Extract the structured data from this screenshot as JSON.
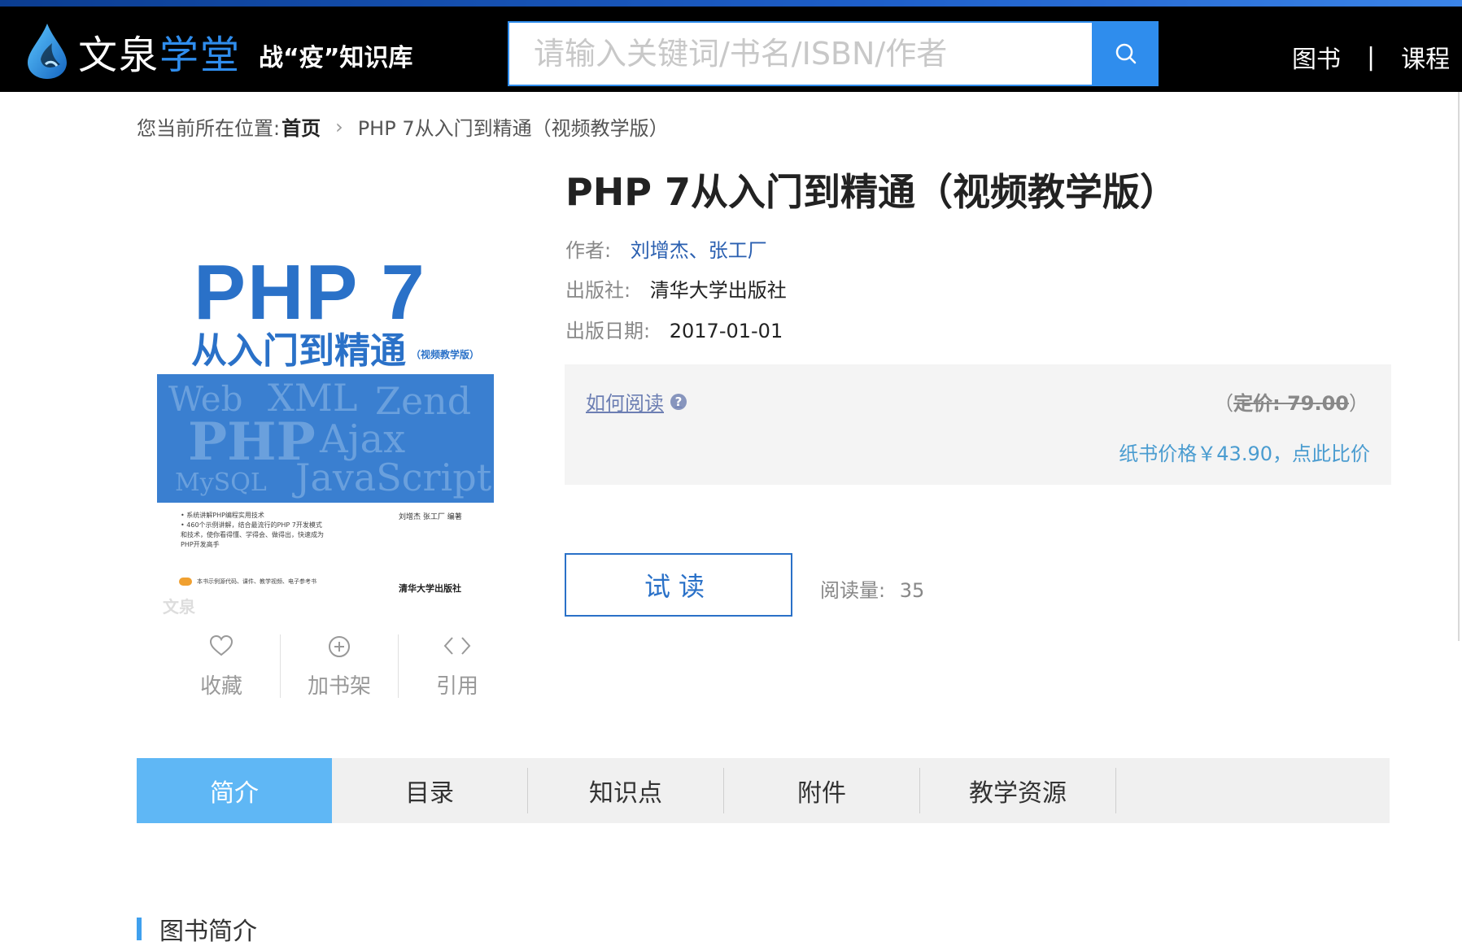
{
  "header": {
    "logo_main": "文泉",
    "logo_accent": "学堂",
    "logo_tag": "战“疫”知识库",
    "search_placeholder": "请输入关键词/书名/ISBN/作者",
    "nav": [
      "图书",
      "|",
      "课程"
    ]
  },
  "breadcrumb": {
    "prefix": "您当前所在位置:",
    "home": "首页",
    "current": "PHP 7从入门到精通（视频教学版）"
  },
  "cover": {
    "title_line1": "PHP 7",
    "title_line2": "从入门到精通",
    "title_edition": "（视频教学版）",
    "watermark_words": [
      "Web",
      "XML",
      "Zend",
      "PHP",
      "Ajax",
      "MySQL",
      "JavaScript"
    ],
    "bullets": [
      "• 系统讲解PHP编程实用技术",
      "• 460个示例讲解，结合最流行的PHP 7开发模式和技术，使你看得懂、学得会、做得出，快速成为PHP开发高手"
    ],
    "author": "刘增杰 张工厂 编著",
    "footer_note": "本书示例源代码、课件、教学视频、电子参考书",
    "publisher": "清华大学出版社",
    "watermark_logo": "文泉"
  },
  "actions": [
    {
      "label": "收藏",
      "icon": "heart-icon"
    },
    {
      "label": "加书架",
      "icon": "plus-circle-icon"
    },
    {
      "label": "引用",
      "icon": "code-brackets-icon"
    }
  ],
  "book": {
    "title": "PHP 7从入门到精通（视频教学版）",
    "author_label": "作者:",
    "authors": "刘增杰、张工厂",
    "publisher_label": "出版社:",
    "publisher": "清华大学出版社",
    "date_label": "出版日期:",
    "date": "2017-01-01"
  },
  "pricing": {
    "how_to_read": "如何阅读",
    "list_price_open": "（",
    "list_price": "定价: 79.00",
    "list_price_close": "）",
    "paper_price": "纸书价格￥43.90，点此比价"
  },
  "reading": {
    "try_label": "试读",
    "count_label": "阅读量:",
    "count": "35"
  },
  "tabs": [
    {
      "label": "简介",
      "active": true
    },
    {
      "label": "目录",
      "active": false
    },
    {
      "label": "知识点",
      "active": false
    },
    {
      "label": "附件",
      "active": false
    },
    {
      "label": "教学资源",
      "active": false
    }
  ],
  "section": {
    "title": "图书简介"
  },
  "colors": {
    "accent": "#2f8ded",
    "tab_active": "#5fb7f5",
    "cover_blue": "#2a71c8",
    "header_bg": "#000000"
  }
}
